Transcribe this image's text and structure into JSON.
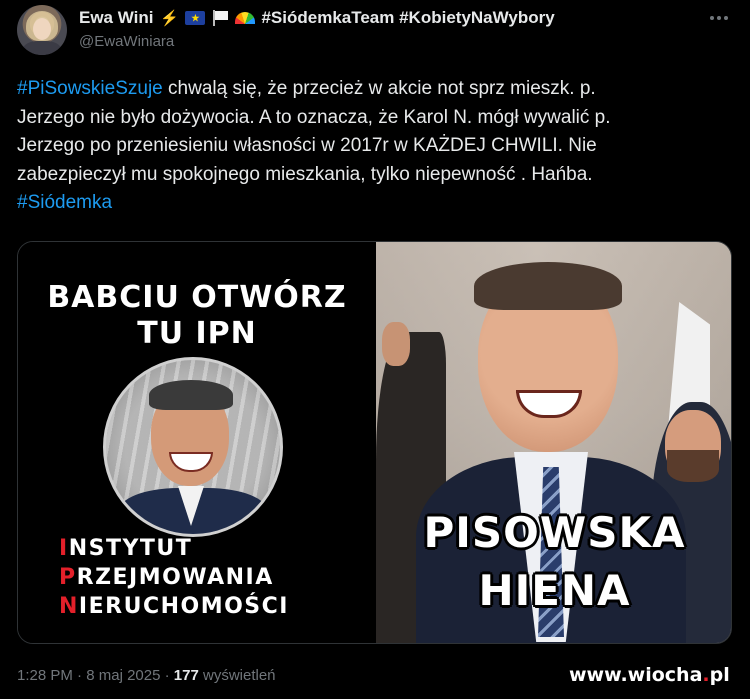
{
  "author": {
    "name": "Ewa Wini",
    "badges": [
      "⚡",
      "🇪🇺",
      "🏳",
      "🌈"
    ],
    "hashtags": "#SiódemkaTeam #KobietyNaWybory",
    "handle": "@EwaWiniara"
  },
  "tweet": {
    "lines": [
      {
        "hashtag": "#PiSowskieSzuje",
        "text": " chwalą się, że przecież w akcie not sprz mieszk. p."
      },
      {
        "hashtag": "",
        "text": "Jerzego nie było dożywocia. A to oznacza, że Karol N. mógł wywalić p."
      },
      {
        "hashtag": "",
        "text": "Jerzego po przeniesieniu własności w 2017r  w KAŻDEJ CHWILI.  Nie"
      },
      {
        "hashtag": "",
        "text": "zabezpieczył mu spokojnego mieszkania, tylko niepewność . Hańba."
      },
      {
        "hashtag": "#Siódemka",
        "text": ""
      }
    ]
  },
  "media": {
    "left_title_1": "BABCIU OTWÓRZ",
    "left_title_2": "TU IPN",
    "ipn_1_first": "I",
    "ipn_1_rest": "NSTYTUT",
    "ipn_2_first": "P",
    "ipn_2_rest": "RZEJMOWANIA",
    "ipn_3_first": "N",
    "ipn_3_rest": "IERUCHOMOŚCI",
    "right_caption_1": "PISOWSKA",
    "right_caption_2": "HIENA",
    "accent_red": "#e3202a"
  },
  "footer": {
    "time": "1:28 PM",
    "sep1": " · ",
    "date": "8 maj 2025",
    "sep2": " · ",
    "views_count": "177",
    "views_label": " wyświetleń"
  },
  "watermark": {
    "prefix": "www.wiocha",
    "dot": ".",
    "tld": "pl"
  },
  "colors": {
    "background": "#000000",
    "text": "#e7e9ea",
    "muted": "#71767b",
    "link": "#1d9bf0"
  }
}
